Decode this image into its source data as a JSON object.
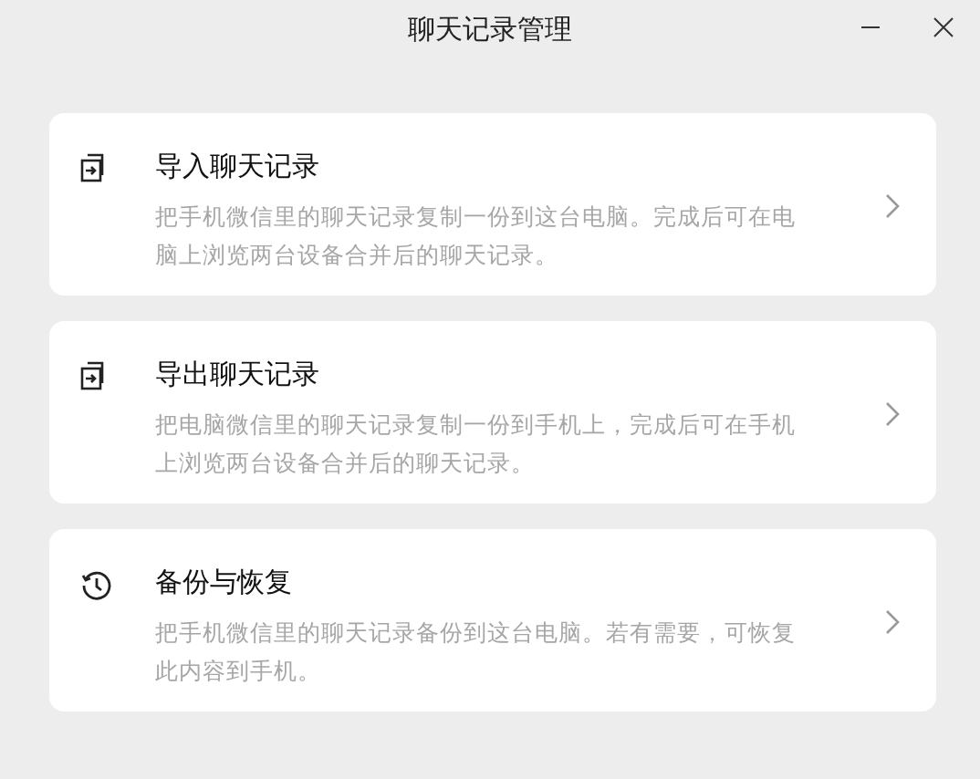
{
  "window": {
    "title": "聊天记录管理"
  },
  "options": [
    {
      "kind": "import",
      "title": "导入聊天记录",
      "description": "把手机微信里的聊天记录复制一份到这台电脑。完成后可在电脑上浏览两台设备合并后的聊天记录。"
    },
    {
      "kind": "export",
      "title": "导出聊天记录",
      "description": "把电脑微信里的聊天记录复制一份到手机上，完成后可在手机上浏览两台设备合并后的聊天记录。"
    },
    {
      "kind": "history",
      "title": "备份与恢复",
      "description": "把手机微信里的聊天记录备份到这台电脑。若有需要，可恢复此内容到手机。"
    }
  ]
}
